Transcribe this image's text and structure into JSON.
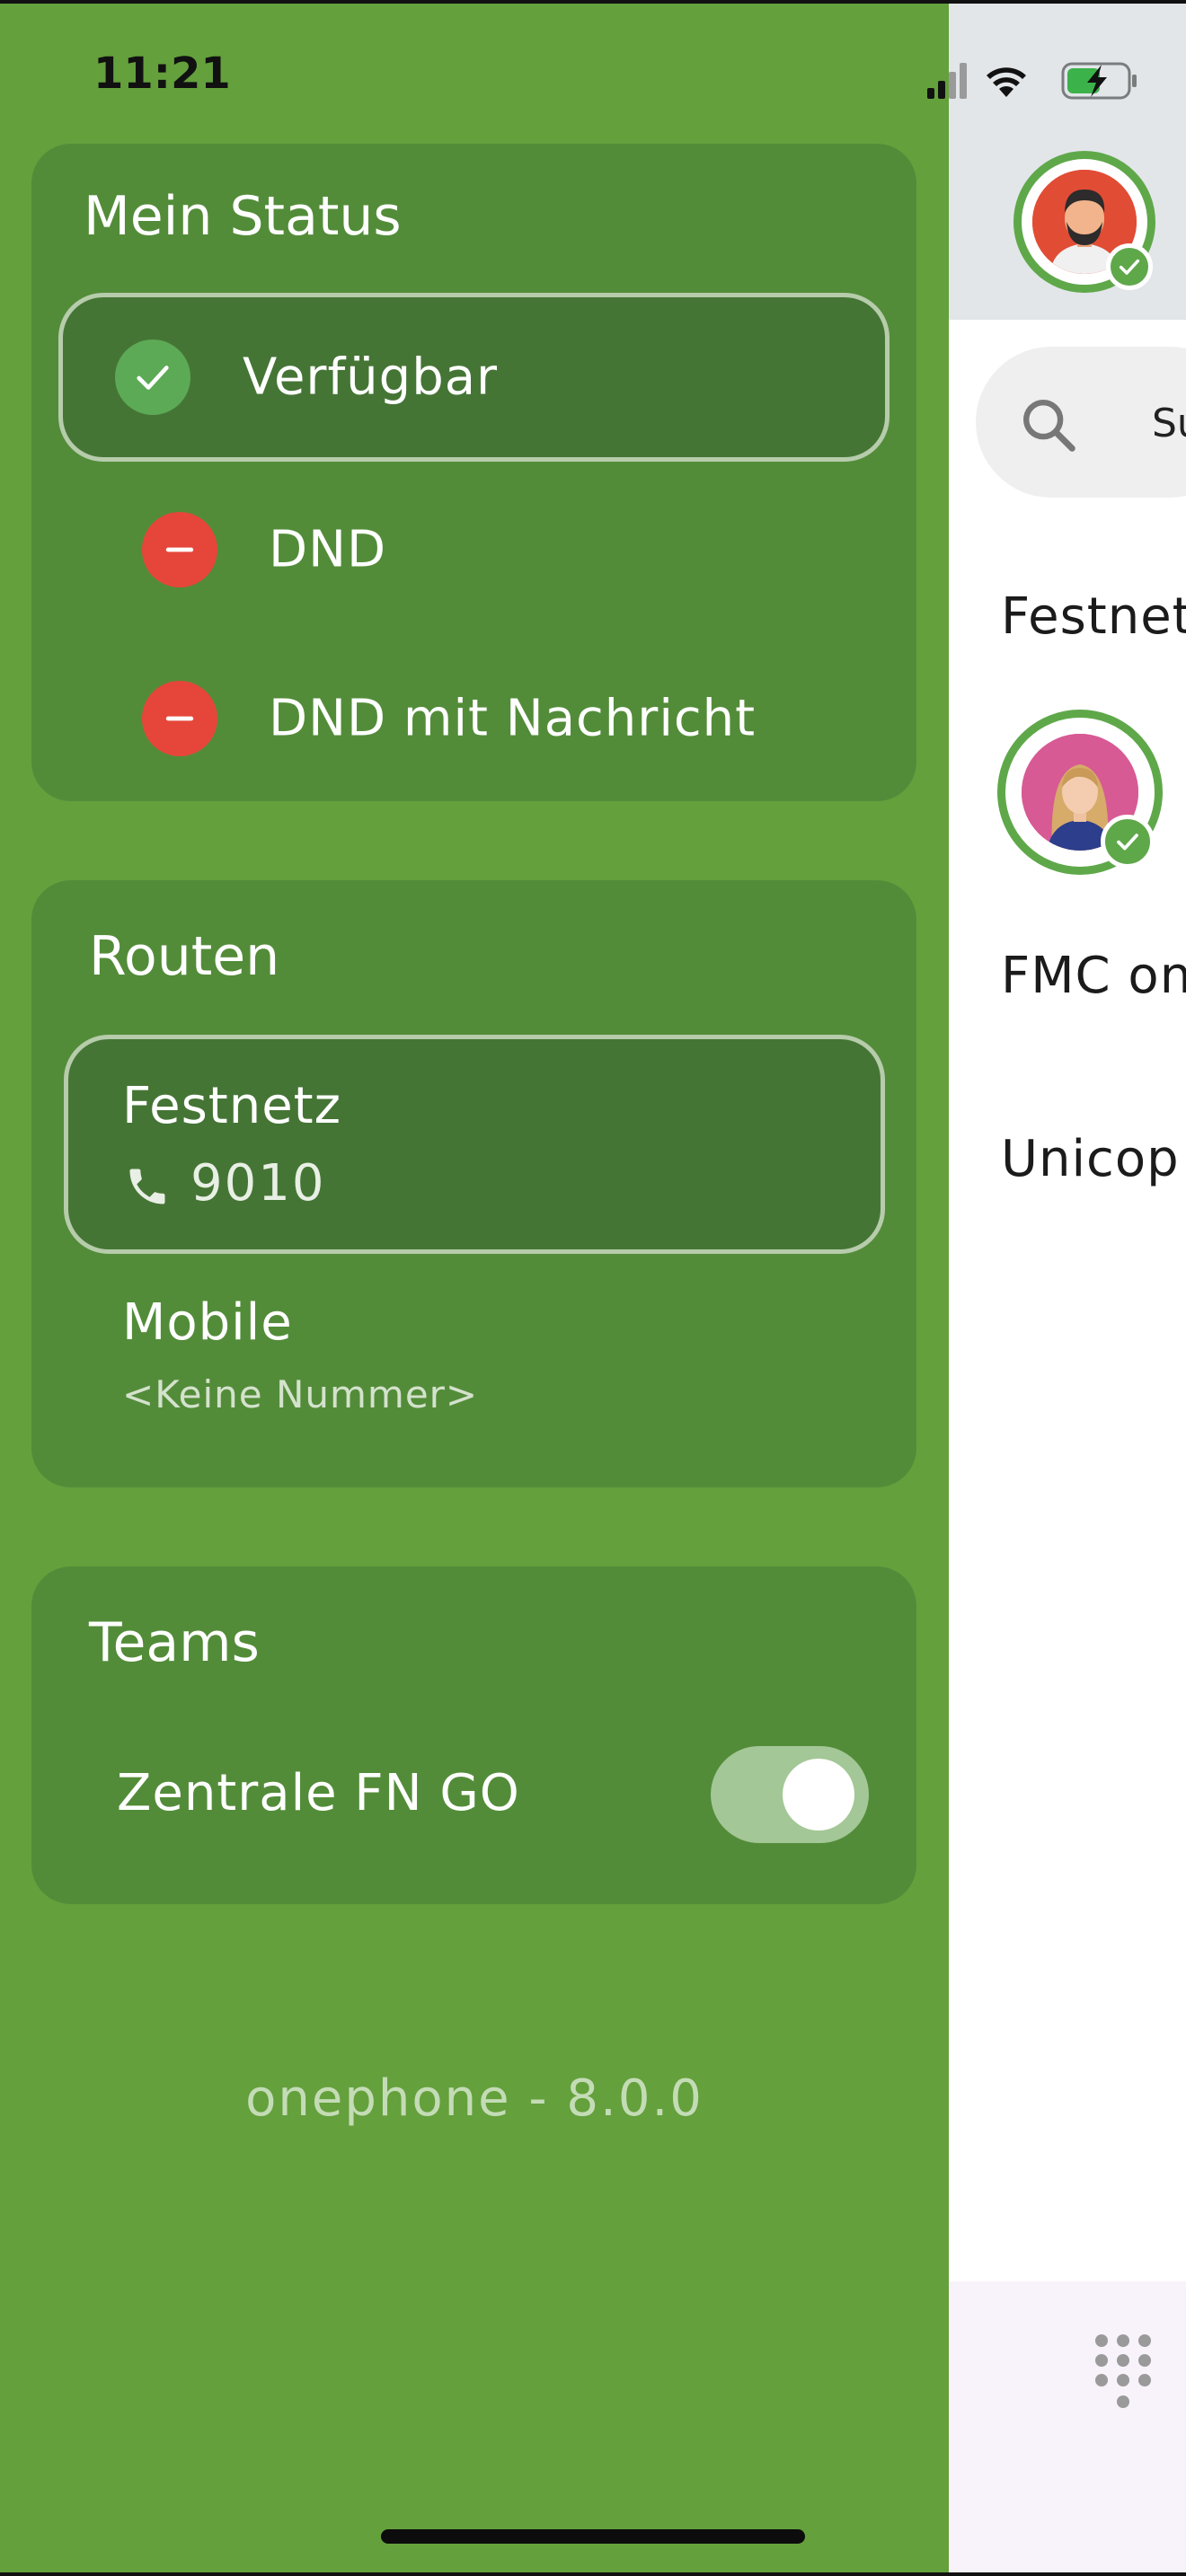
{
  "status_bar": {
    "time": "11:21",
    "icons": [
      "cellular-signal-icon",
      "wifi-icon",
      "battery-charging-icon"
    ]
  },
  "drawer": {
    "status_card": {
      "title": "Mein Status",
      "items": [
        {
          "label": "Verfügbar",
          "icon": "check-icon",
          "color": "#5caa55",
          "selected": true
        },
        {
          "label": "DND",
          "icon": "minus-icon",
          "color": "#e6463a",
          "selected": false
        },
        {
          "label": "DND mit Nachricht",
          "icon": "minus-icon",
          "color": "#e6463a",
          "selected": false
        }
      ]
    },
    "routes_card": {
      "title": "Routen",
      "items": [
        {
          "name": "Festnetz",
          "number": "9010",
          "icon": "phone-icon",
          "selected": true
        },
        {
          "name": "Mobile",
          "number": "<Keine Nummer>",
          "selected": false
        }
      ]
    },
    "teams_card": {
      "title": "Teams",
      "items": [
        {
          "label": "Zentrale FN GO",
          "enabled": true
        }
      ]
    },
    "version": "onephone - 8.0.0"
  },
  "app": {
    "search": {
      "text": "Suc",
      "icon": "search-icon"
    },
    "sections": [
      "Festnet",
      "FMC on",
      "Unicop"
    ],
    "bottom": {
      "icon": "dialpad-icon"
    }
  },
  "colors": {
    "drawer_bg": "#64a03c",
    "card_bg": "#538c39",
    "selected_bg": "#457535",
    "available": "#5caa55",
    "dnd": "#e6463a"
  }
}
